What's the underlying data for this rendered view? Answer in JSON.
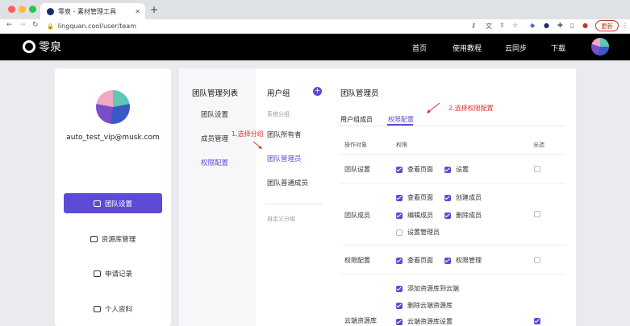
{
  "browser": {
    "tab_title": "零泉 - 素材管理工具",
    "url": "lingquan.cool/user/team",
    "update_label": "更新"
  },
  "site": {
    "logo_text": "零泉",
    "nav": [
      "首页",
      "使用教程",
      "云同步",
      "下载"
    ]
  },
  "profile": {
    "email": "auto_test_vip@musk.com",
    "menu": [
      "团队设置",
      "资源库管理",
      "申请记录",
      "个人资料"
    ]
  },
  "team_panel": {
    "title": "团队管理列表",
    "items": [
      "团队设置",
      "成员管理",
      "权限配置"
    ]
  },
  "group_panel": {
    "title": "用户组",
    "system_tag": "系统分组",
    "groups": [
      "团队所有者",
      "团队管理员",
      "团队普通成员"
    ],
    "custom_tag": "自定义分组"
  },
  "detail": {
    "title": "团队管理员",
    "tabs": [
      "用户组成员",
      "权限配置"
    ],
    "headers": [
      "操作对象",
      "权限",
      "全选"
    ],
    "rows": [
      {
        "label": "团队设置",
        "perms": [
          {
            "name": "查看页面",
            "checked": true
          },
          {
            "name": "设置",
            "checked": true
          }
        ]
      },
      {
        "label": "团队成员",
        "perms": [
          {
            "name": "查看页面",
            "checked": true
          },
          {
            "name": "创建成员",
            "checked": true
          },
          {
            "name": "编辑成员",
            "checked": true
          },
          {
            "name": "删除成员",
            "checked": true
          },
          {
            "name": "设置管理员",
            "checked": false
          }
        ]
      },
      {
        "label": "权限配置",
        "perms": [
          {
            "name": "查看页面",
            "checked": true
          },
          {
            "name": "权限管理",
            "checked": true
          }
        ]
      },
      {
        "label": "云端资源库",
        "perms": [
          {
            "name": "添加资源库到云端",
            "checked": true
          },
          {
            "name": "删除云端资源库",
            "checked": true
          },
          {
            "name": "云端资源库设置",
            "checked": true
          }
        ]
      }
    ]
  },
  "annotations": {
    "step1": "1.选择分组",
    "step2": "2.选择权限配置"
  },
  "colors": {
    "accent": "#5b4bd6",
    "annotation": "#e03131"
  }
}
